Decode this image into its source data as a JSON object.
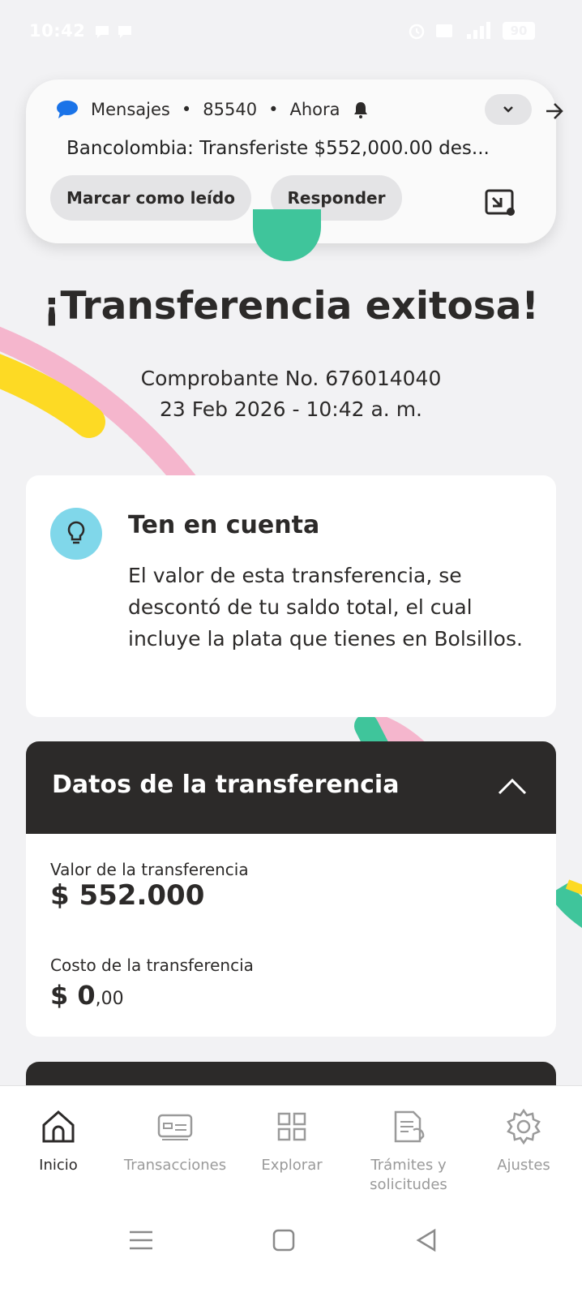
{
  "status_bar": {
    "time": "10:42",
    "battery": "90"
  },
  "notification": {
    "app": "Mensajes",
    "sender": "85540",
    "when": "Ahora",
    "separator": "•",
    "body": "Bancolombia: Transferiste $552,000.00 des...",
    "mark_read_label": "Marcar como leído",
    "reply_label": "Responder"
  },
  "confirmation": {
    "title": "¡Transferencia exitosa!",
    "voucher": "Comprobante No. 676014040",
    "datetime": "23 Feb 2026 - 10:42 a. m."
  },
  "info_card": {
    "title": "Ten en cuenta",
    "text": "El valor de esta transferencia, se descontó de tu saldo total, el cual incluye la plata que tienes en Bolsillos."
  },
  "transfer_details": {
    "header": "Datos de la transferencia",
    "amount_label": "Valor de la transferencia",
    "amount_value": "$ 552.000",
    "cost_label": "Costo de la transferencia",
    "cost_value_main": "$ 0",
    "cost_value_cents": ",00"
  },
  "bottom_nav": {
    "items": [
      {
        "label": "Inicio",
        "icon": "home-icon",
        "active": true
      },
      {
        "label": "Transacciones",
        "icon": "card-icon",
        "active": false
      },
      {
        "label": "Explorar",
        "icon": "grid-icon",
        "active": false
      },
      {
        "label": "Trámites y solicitudes",
        "icon": "document-icon",
        "active": false
      },
      {
        "label": "Ajustes",
        "icon": "gear-icon",
        "active": false
      }
    ]
  },
  "colors": {
    "dark": "#2c2a29",
    "accent_green": "#3fc59b",
    "accent_yellow": "#fdda24",
    "accent_pink": "#f5b6cd",
    "bulb_blue": "#80d7ea"
  }
}
